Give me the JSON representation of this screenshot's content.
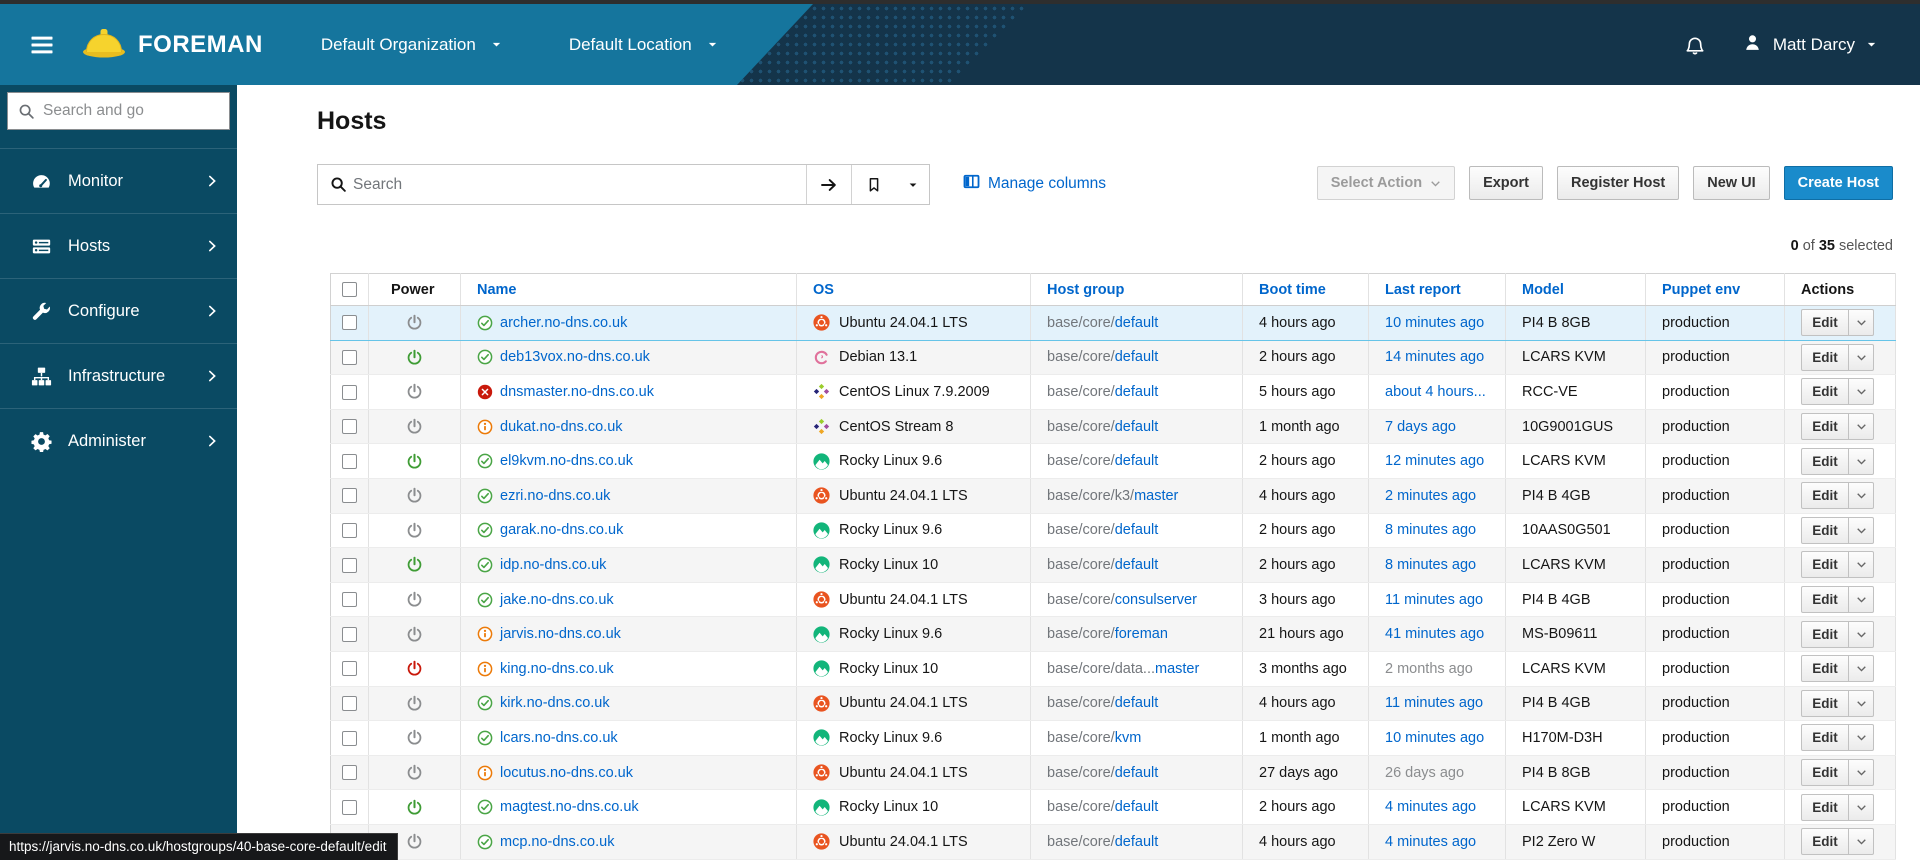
{
  "navbar": {
    "brand": "FOREMAN",
    "organization": "Default Organization",
    "location": "Default Location",
    "user": "Matt Darcy"
  },
  "sidebar": {
    "search_placeholder": "Search and go",
    "items": [
      {
        "label": "Monitor",
        "icon": "gauge-icon"
      },
      {
        "label": "Hosts",
        "icon": "server-icon"
      },
      {
        "label": "Configure",
        "icon": "wrench-icon"
      },
      {
        "label": "Infrastructure",
        "icon": "sitemap-icon"
      },
      {
        "label": "Administer",
        "icon": "gear-icon"
      }
    ]
  },
  "page": {
    "title": "Hosts",
    "search_placeholder": "Search",
    "manage_columns": "Manage columns",
    "buttons": {
      "select_action": "Select Action",
      "export": "Export",
      "register_host": "Register Host",
      "new_ui": "New UI",
      "create_host": "Create Host"
    },
    "summary": {
      "count": "0",
      "of_label": "of",
      "total": "35",
      "selected_label": "selected"
    }
  },
  "table": {
    "columns": [
      {
        "label": "",
        "key": "check",
        "sortable": false
      },
      {
        "label": "Power",
        "key": "power",
        "sortable": false
      },
      {
        "label": "Name",
        "key": "name",
        "sortable": true
      },
      {
        "label": "OS",
        "key": "os",
        "sortable": true
      },
      {
        "label": "Host group",
        "key": "hostgroup",
        "sortable": true
      },
      {
        "label": "Boot time",
        "key": "boottime",
        "sortable": true
      },
      {
        "label": "Last report",
        "key": "lastreport",
        "sortable": true
      },
      {
        "label": "Model",
        "key": "model",
        "sortable": true
      },
      {
        "label": "Puppet env",
        "key": "puppet",
        "sortable": true
      },
      {
        "label": "Actions",
        "key": "actions",
        "sortable": false
      }
    ],
    "edit_label": "Edit",
    "rows": [
      {
        "power": "gray",
        "status": "ok",
        "name": "archer.no-dns.co.uk",
        "os_icon": "ubuntu",
        "os": "Ubuntu 24.04.1 LTS",
        "hg_prefix": "base/core/",
        "hg_link": "default",
        "boot": "4 hours ago",
        "report": "10 minutes ago",
        "report_muted": false,
        "model": "PI4 B 8GB",
        "puppet": "production",
        "highlighted": true
      },
      {
        "power": "green",
        "status": "ok",
        "name": "deb13vox.no-dns.co.uk",
        "os_icon": "debian",
        "os": "Debian 13.1",
        "hg_prefix": "base/core/",
        "hg_link": "default",
        "boot": "2 hours ago",
        "report": "14 minutes ago",
        "report_muted": false,
        "model": "LCARS KVM",
        "puppet": "production",
        "highlighted": false
      },
      {
        "power": "gray",
        "status": "error",
        "name": "dnsmaster.no-dns.co.uk",
        "os_icon": "centos",
        "os": "CentOS Linux 7.9.2009",
        "hg_prefix": "base/core/",
        "hg_link": "default",
        "boot": "5 hours ago",
        "report": "about 4 hours...",
        "report_muted": false,
        "model": "RCC-VE",
        "puppet": "production",
        "highlighted": false
      },
      {
        "power": "gray",
        "status": "warning",
        "name": "dukat.no-dns.co.uk",
        "os_icon": "centos",
        "os": "CentOS Stream 8",
        "hg_prefix": "base/core/",
        "hg_link": "default",
        "boot": "1 month ago",
        "report": "7 days ago",
        "report_muted": false,
        "model": "10G9001GUS",
        "puppet": "production",
        "highlighted": false
      },
      {
        "power": "green",
        "status": "ok",
        "name": "el9kvm.no-dns.co.uk",
        "os_icon": "rocky",
        "os": "Rocky Linux 9.6",
        "hg_prefix": "base/core/",
        "hg_link": "default",
        "boot": "2 hours ago",
        "report": "12 minutes ago",
        "report_muted": false,
        "model": "LCARS KVM",
        "puppet": "production",
        "highlighted": false
      },
      {
        "power": "gray",
        "status": "ok",
        "name": "ezri.no-dns.co.uk",
        "os_icon": "ubuntu",
        "os": "Ubuntu 24.04.1 LTS",
        "hg_prefix": "base/core/k3/",
        "hg_link": "master",
        "boot": "4 hours ago",
        "report": "2 minutes ago",
        "report_muted": false,
        "model": "PI4 B 4GB",
        "puppet": "production",
        "highlighted": false
      },
      {
        "power": "gray",
        "status": "ok",
        "name": "garak.no-dns.co.uk",
        "os_icon": "rocky",
        "os": "Rocky Linux 9.6",
        "hg_prefix": "base/core/",
        "hg_link": "default",
        "boot": "2 hours ago",
        "report": "8 minutes ago",
        "report_muted": false,
        "model": "10AAS0G501",
        "puppet": "production",
        "highlighted": false
      },
      {
        "power": "green",
        "status": "ok",
        "name": "idp.no-dns.co.uk",
        "os_icon": "rocky",
        "os": "Rocky Linux 10",
        "hg_prefix": "base/core/",
        "hg_link": "default",
        "boot": "2 hours ago",
        "report": "8 minutes ago",
        "report_muted": false,
        "model": "LCARS KVM",
        "puppet": "production",
        "highlighted": false
      },
      {
        "power": "gray",
        "status": "ok",
        "name": "jake.no-dns.co.uk",
        "os_icon": "ubuntu",
        "os": "Ubuntu 24.04.1 LTS",
        "hg_prefix": "base/core/",
        "hg_link": "consulserver",
        "boot": "3 hours ago",
        "report": "11 minutes ago",
        "report_muted": false,
        "model": "PI4 B 4GB",
        "puppet": "production",
        "highlighted": false
      },
      {
        "power": "gray",
        "status": "warning",
        "name": "jarvis.no-dns.co.uk",
        "os_icon": "rocky",
        "os": "Rocky Linux 9.6",
        "hg_prefix": "base/core/",
        "hg_link": "foreman",
        "boot": "21 hours ago",
        "report": "41 minutes ago",
        "report_muted": false,
        "model": "MS-B09611",
        "puppet": "production",
        "highlighted": false
      },
      {
        "power": "red",
        "status": "warning",
        "name": "king.no-dns.co.uk",
        "os_icon": "rocky",
        "os": "Rocky Linux 10",
        "hg_prefix": "base/core/data...",
        "hg_link": "master",
        "boot": "3 months ago",
        "report": "2 months ago",
        "report_muted": true,
        "model": "LCARS KVM",
        "puppet": "production",
        "highlighted": false
      },
      {
        "power": "gray",
        "status": "ok",
        "name": "kirk.no-dns.co.uk",
        "os_icon": "ubuntu",
        "os": "Ubuntu 24.04.1 LTS",
        "hg_prefix": "base/core/",
        "hg_link": "default",
        "boot": "4 hours ago",
        "report": "11 minutes ago",
        "report_muted": false,
        "model": "PI4 B 4GB",
        "puppet": "production",
        "highlighted": false
      },
      {
        "power": "gray",
        "status": "ok",
        "name": "lcars.no-dns.co.uk",
        "os_icon": "rocky",
        "os": "Rocky Linux 9.6",
        "hg_prefix": "base/core/",
        "hg_link": "kvm",
        "boot": "1 month ago",
        "report": "10 minutes ago",
        "report_muted": false,
        "model": "H170M-D3H",
        "puppet": "production",
        "highlighted": false
      },
      {
        "power": "gray",
        "status": "warning",
        "name": "locutus.no-dns.co.uk",
        "os_icon": "ubuntu",
        "os": "Ubuntu 24.04.1 LTS",
        "hg_prefix": "base/core/",
        "hg_link": "default",
        "boot": "27 days ago",
        "report": "26 days ago",
        "report_muted": true,
        "model": "PI4 B 8GB",
        "puppet": "production",
        "highlighted": false
      },
      {
        "power": "green",
        "status": "ok",
        "name": "magtest.no-dns.co.uk",
        "os_icon": "rocky",
        "os": "Rocky Linux 10",
        "hg_prefix": "base/core/",
        "hg_link": "default",
        "boot": "2 hours ago",
        "report": "4 minutes ago",
        "report_muted": false,
        "model": "LCARS KVM",
        "puppet": "production",
        "highlighted": false
      },
      {
        "power": "gray",
        "status": "ok",
        "name": "mcp.no-dns.co.uk",
        "os_icon": "ubuntu",
        "os": "Ubuntu 24.04.1 LTS",
        "hg_prefix": "base/core/",
        "hg_link": "default",
        "boot": "4 hours ago",
        "report": "4 minutes ago",
        "report_muted": false,
        "model": "PI2 Zero W",
        "puppet": "production",
        "highlighted": false
      }
    ]
  },
  "statusbar": {
    "url": "https://jarvis.no-dns.co.uk/hostgroups/40-base-core-default/edit"
  },
  "colors": {
    "navbar_teal": "#15759d",
    "navbar_dark": "#14344a",
    "sidebar": "#0a4a63",
    "link_blue": "#0066cc",
    "primary_button": "#1a8bcb",
    "success_green": "#3f9c35",
    "danger_red": "#c9190b",
    "warning_orange": "#ec7a08"
  }
}
